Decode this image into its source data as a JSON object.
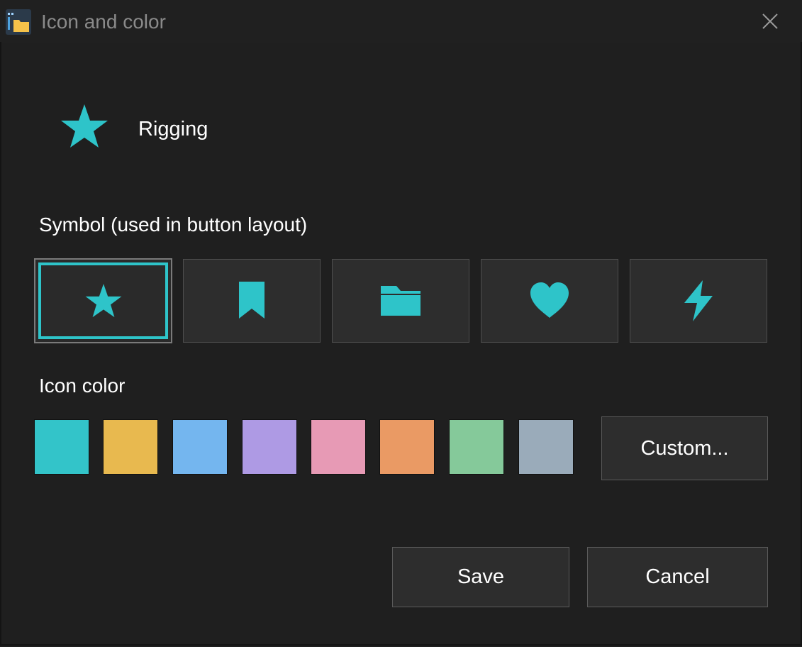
{
  "window": {
    "title": "Icon and color"
  },
  "preview": {
    "icon": "star-icon",
    "name": "Rigging"
  },
  "symbol_section": {
    "label": "Symbol (used in button layout)",
    "options": [
      {
        "icon": "star-icon",
        "selected": true
      },
      {
        "icon": "bookmark-icon",
        "selected": false
      },
      {
        "icon": "folder-icon",
        "selected": false
      },
      {
        "icon": "heart-icon",
        "selected": false
      },
      {
        "icon": "lightning-icon",
        "selected": false
      }
    ]
  },
  "color_section": {
    "label": "Icon color",
    "swatches": [
      "#33c4c9",
      "#e8b94f",
      "#74b6ef",
      "#ae9ae4",
      "#e79ab5",
      "#ea9a64",
      "#85c99a",
      "#9aabba"
    ],
    "custom_label": "Custom..."
  },
  "actions": {
    "save_label": "Save",
    "cancel_label": "Cancel"
  },
  "colors": {
    "accent": "#2ec4c9",
    "background": "#1f1f1f",
    "button_bg": "#2d2d2d"
  }
}
